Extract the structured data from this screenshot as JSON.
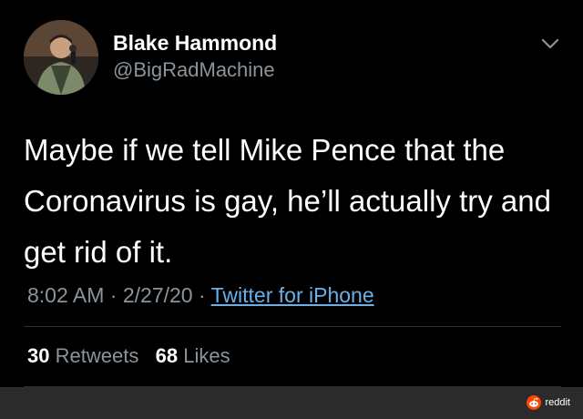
{
  "tweet": {
    "display_name": "Blake Hammond",
    "handle": "@BigRadMachine",
    "text": "Maybe if we tell Mike Pence that the Coronavirus is gay, he’ll actually try and get rid of it.",
    "time": "8:02 AM",
    "date": "2/27/20",
    "source": "Twitter for iPhone",
    "separator": "·",
    "retweets_count": "30",
    "retweets_label": "Retweets",
    "likes_count": "68",
    "likes_label": "Likes"
  },
  "footer": {
    "watermark": "reddit"
  },
  "colors": {
    "background": "#000000",
    "text": "#ffffff",
    "secondary_text": "#8a949c",
    "link": "#6ab0e8",
    "footer_bar": "#2b2b2b",
    "reddit_orange": "#ff4500"
  },
  "icons": {
    "caret": "chevron-down-icon",
    "watermark": "reddit-logo-icon"
  }
}
